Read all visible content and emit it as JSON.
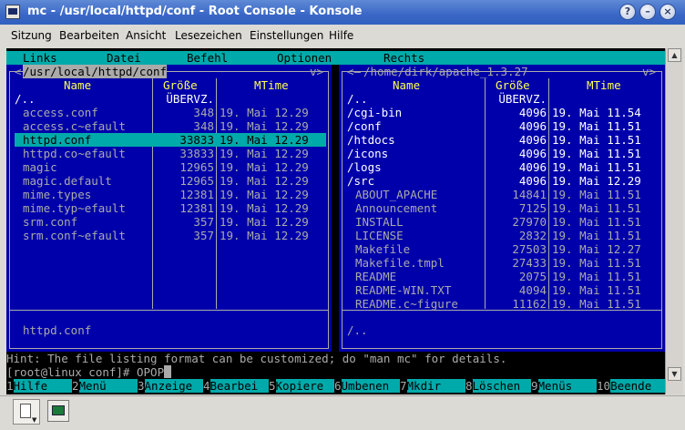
{
  "window": {
    "title": "mc - /usr/local/httpd/conf - Root Console - Konsole"
  },
  "menubar": {
    "items": [
      "Sitzung",
      "Bearbeiten",
      "Ansicht",
      "Lesezeichen",
      "Einstellungen",
      "Hilfe"
    ]
  },
  "mc_menu": {
    "items": [
      "Links",
      "Datei",
      "Befehl",
      "Optionen",
      "Rechts"
    ]
  },
  "left_panel": {
    "path": "/usr/local/httpd/conf",
    "path_suffix": "v>",
    "headers": {
      "name": "Name",
      "size": "Größe",
      "mtime": "MTime"
    },
    "rows": [
      {
        "name": "/..",
        "size": "ÜBERVZ.",
        "mtime": "",
        "kind": "dir"
      },
      {
        "name": "access.conf",
        "size": "348",
        "mtime": "19. Mai 12.29",
        "kind": "file"
      },
      {
        "name": "access.c~efault",
        "size": "348",
        "mtime": "19. Mai 12.29",
        "kind": "file"
      },
      {
        "name": "httpd.conf",
        "size": "33833",
        "mtime": "19. Mai 12.29",
        "kind": "selected"
      },
      {
        "name": "httpd.co~efault",
        "size": "33833",
        "mtime": "19. Mai 12.29",
        "kind": "file"
      },
      {
        "name": "magic",
        "size": "12965",
        "mtime": "19. Mai 12.29",
        "kind": "file"
      },
      {
        "name": "magic.default",
        "size": "12965",
        "mtime": "19. Mai 12.29",
        "kind": "file"
      },
      {
        "name": "mime.types",
        "size": "12381",
        "mtime": "19. Mai 12.29",
        "kind": "file"
      },
      {
        "name": "mime.typ~efault",
        "size": "12381",
        "mtime": "19. Mai 12.29",
        "kind": "file"
      },
      {
        "name": "srm.conf",
        "size": "357",
        "mtime": "19. Mai 12.29",
        "kind": "file"
      },
      {
        "name": "srm.conf~efault",
        "size": "357",
        "mtime": "19. Mai 12.29",
        "kind": "file"
      }
    ],
    "footer": "httpd.conf"
  },
  "right_panel": {
    "path": "/home/dirk/apache_1.3.27",
    "path_suffix": "v>",
    "headers": {
      "name": "Name",
      "size": "Größe",
      "mtime": "MTime"
    },
    "rows": [
      {
        "name": "/..",
        "size": "ÜBERVZ.",
        "mtime": "",
        "kind": "dir"
      },
      {
        "name": "/cgi-bin",
        "size": "4096",
        "mtime": "19. Mai 11.54",
        "kind": "dir"
      },
      {
        "name": "/conf",
        "size": "4096",
        "mtime": "19. Mai 11.51",
        "kind": "dir"
      },
      {
        "name": "/htdocs",
        "size": "4096",
        "mtime": "19. Mai 11.51",
        "kind": "dir"
      },
      {
        "name": "/icons",
        "size": "4096",
        "mtime": "19. Mai 11.51",
        "kind": "dir"
      },
      {
        "name": "/logs",
        "size": "4096",
        "mtime": "19. Mai 11.51",
        "kind": "dir"
      },
      {
        "name": "/src",
        "size": "4096",
        "mtime": "19. Mai 12.29",
        "kind": "dir"
      },
      {
        "name": "ABOUT_APACHE",
        "size": "14841",
        "mtime": "19. Mai 11.51",
        "kind": "file"
      },
      {
        "name": "Announcement",
        "size": "7125",
        "mtime": "19. Mai 11.51",
        "kind": "file"
      },
      {
        "name": "INSTALL",
        "size": "27970",
        "mtime": "19. Mai 11.51",
        "kind": "file"
      },
      {
        "name": "LICENSE",
        "size": "2832",
        "mtime": "19. Mai 11.51",
        "kind": "file"
      },
      {
        "name": "Makefile",
        "size": "27503",
        "mtime": "19. Mai 12.27",
        "kind": "file"
      },
      {
        "name": "Makefile.tmpl",
        "size": "27433",
        "mtime": "19. Mai 11.51",
        "kind": "file"
      },
      {
        "name": "README",
        "size": "2075",
        "mtime": "19. Mai 11.51",
        "kind": "file"
      },
      {
        "name": "README-WIN.TXT",
        "size": "4094",
        "mtime": "19. Mai 11.51",
        "kind": "file"
      },
      {
        "name": "README.c~figure",
        "size": "11162",
        "mtime": "19. Mai 11.51",
        "kind": "file"
      }
    ],
    "footer": "/.."
  },
  "hint": "Hint: The file listing format can be customized; do \"man mc\" for details.",
  "command_line": "[root@linux conf]# OPOP",
  "function_keys": [
    {
      "num": "1",
      "label": "Hilfe"
    },
    {
      "num": "2",
      "label": "Menü"
    },
    {
      "num": "3",
      "label": "Anzeige"
    },
    {
      "num": "4",
      "label": "Bearbei"
    },
    {
      "num": "5",
      "label": "Kopiere"
    },
    {
      "num": "6",
      "label": "Umbenen"
    },
    {
      "num": "7",
      "label": "Mkdir"
    },
    {
      "num": "8",
      "label": "Löschen"
    },
    {
      "num": "9",
      "label": "Menüs"
    },
    {
      "num": "10",
      "label": "Beende"
    }
  ],
  "icons": {
    "app": "konsole-icon",
    "help": "help-icon",
    "minimize": "minimize-icon",
    "maximize": "maximize-icon",
    "close": "close-icon",
    "new_session": "new-session-icon",
    "session_tab": "terminal-session-icon"
  }
}
